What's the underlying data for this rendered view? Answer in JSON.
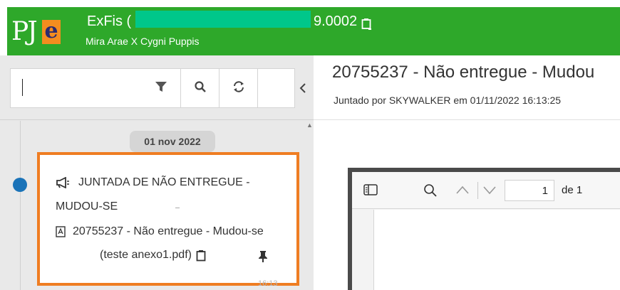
{
  "header": {
    "title_prefix": "ExFis (",
    "title_suffix": "9.0002",
    "subtitle": "Mira Arae X Cygni Puppis",
    "logo_text": "PJe",
    "bg_color": "#2ea82a"
  },
  "sidebar": {
    "search_placeholder": "",
    "filter_icon": "filter-icon",
    "search_icon": "search-icon",
    "refresh_icon": "refresh-icon",
    "collapse_icon": "chevron-left-icon",
    "date_badge": "01 nov 2022",
    "card": {
      "title_line1": "JUNTADA DE NÃO ENTREGUE -",
      "title_line2": "MUDOU-SE",
      "doc_line1": "20755237 - Não entregue - Mudou-se",
      "doc_line2": "(teste anexo1.pdf)",
      "time_partial": "16:13",
      "highlight_color": "#ef7d22"
    }
  },
  "document": {
    "title": "20755237 - Não entregue - Mudou",
    "subtitle": "Juntado por SKYWALKER em 01/11/2022 16:13:25"
  },
  "pdf_viewer": {
    "page_value": "1",
    "page_of": "de 1"
  }
}
